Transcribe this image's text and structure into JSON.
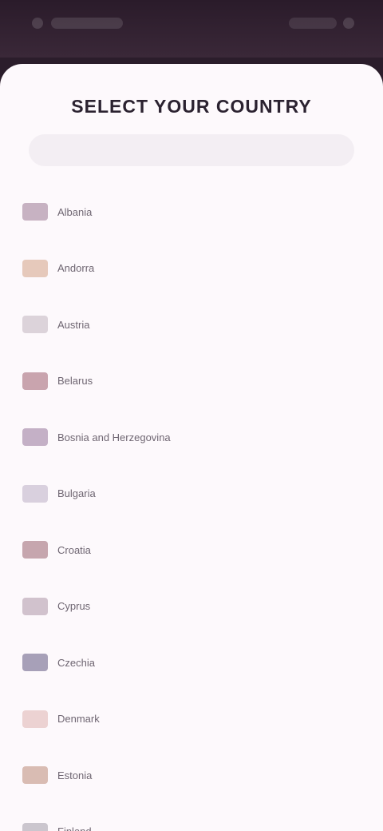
{
  "statusbar": {},
  "sheet": {
    "title": "SELECT YOUR COUNTRY",
    "search_placeholder": ""
  },
  "countries": [
    {
      "label": "Albania",
      "flag_color": "#c7b2c2"
    },
    {
      "label": "Andorra",
      "flag_color": "#e6c9bb"
    },
    {
      "label": "Austria",
      "flag_color": "#dcd3da"
    },
    {
      "label": "Belarus",
      "flag_color": "#c9a4ae"
    },
    {
      "label": "Bosnia and Herzegovina",
      "flag_color": "#c4b0c6"
    },
    {
      "label": "Bulgaria",
      "flag_color": "#d9d0de"
    },
    {
      "label": "Croatia",
      "flag_color": "#c6a6ae"
    },
    {
      "label": "Cyprus",
      "flag_color": "#d1c2cd"
    },
    {
      "label": "Czechia",
      "flag_color": "#a7a0b8"
    },
    {
      "label": "Denmark",
      "flag_color": "#ecd2d2"
    },
    {
      "label": "Estonia",
      "flag_color": "#d9bcb3"
    },
    {
      "label": "Finland",
      "flag_color": "#cbc6ce"
    }
  ]
}
